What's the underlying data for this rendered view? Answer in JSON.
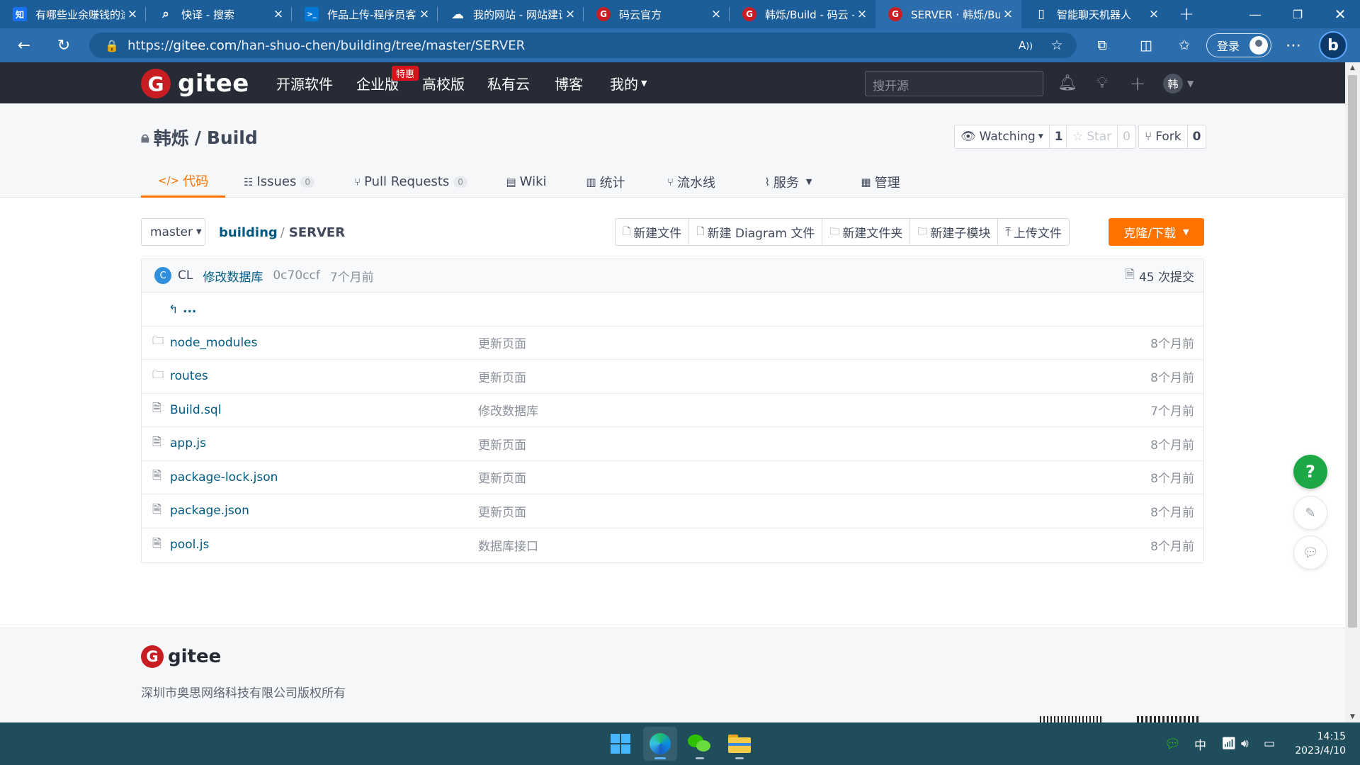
{
  "browser": {
    "tabs": [
      {
        "label": "有哪些业余赚钱的途径",
        "favicon": "知",
        "favicon_color": "#1772f6"
      },
      {
        "label": "快译 - 搜索",
        "favicon": "⌕",
        "favicon_color": "#2c6ead"
      },
      {
        "label": "作品上传-程序员客栈",
        "favicon": ">_",
        "favicon_color": "#0078d4"
      },
      {
        "label": "我的网站 - 网站建设",
        "favicon": "☁",
        "favicon_color": "#2c6ead"
      },
      {
        "label": "码云官方",
        "favicon": "G",
        "favicon_color": "#c71d23"
      },
      {
        "label": "韩烁/Build - 码云 - 开源中国",
        "favicon": "G",
        "favicon_color": "#c71d23"
      },
      {
        "label": "SERVER · 韩烁/Build - 码云",
        "favicon": "G",
        "favicon_color": "#c71d23"
      },
      {
        "label": "智能聊天机器人",
        "favicon": "▯",
        "favicon_color": "#2c6ead"
      }
    ],
    "url_prefix": "https://",
    "url_domain": "gitee.com",
    "url_path": "/han-shuo-chen/building/tree/master/SERVER",
    "login_label": "登录"
  },
  "gitee": {
    "brand": "gitee",
    "nav": [
      "开源软件",
      "企业版",
      "高校版",
      "私有云",
      "博客",
      "我的"
    ],
    "hot_badge": "特惠",
    "search_placeholder": "搜开源",
    "user_avatar": "韩"
  },
  "repo": {
    "owner": "韩烁",
    "name": "Build",
    "watching_label": "Watching",
    "watching_count": "1",
    "star_label": "Star",
    "star_count": "0",
    "fork_label": "Fork",
    "fork_count": "0",
    "tabs": [
      {
        "label": "代码",
        "icon": "</>"
      },
      {
        "label": "Issues",
        "icon": "☷",
        "count": "0"
      },
      {
        "label": "Pull Requests",
        "icon": "⑂",
        "count": "0"
      },
      {
        "label": "Wiki",
        "icon": "▤"
      },
      {
        "label": "统计",
        "icon": "▥"
      },
      {
        "label": "流水线",
        "icon": "⑂"
      },
      {
        "label": "服务",
        "icon": "⌇"
      },
      {
        "label": "管理",
        "icon": "▦"
      }
    ]
  },
  "toolbar": {
    "branch": "master",
    "path_root": "building",
    "path_current": "SERVER",
    "actions": [
      "新建文件",
      "新建 Diagram 文件",
      "新建文件夹",
      "新建子模块",
      "上传文件"
    ],
    "clone_label": "克隆/下载"
  },
  "commit": {
    "avatar": "C",
    "author": "CL",
    "message": "修改数据库",
    "sha": "0c70ccf",
    "time": "7个月前",
    "count_label": "45 次提交"
  },
  "files": {
    "parent_label": "...",
    "rows": [
      {
        "type": "dir",
        "name": "node_modules",
        "message": "更新页面",
        "time": "8个月前"
      },
      {
        "type": "dir",
        "name": "routes",
        "message": "更新页面",
        "time": "8个月前"
      },
      {
        "type": "file",
        "name": "Build.sql",
        "message": "修改数据库",
        "time": "7个月前"
      },
      {
        "type": "file",
        "name": "app.js",
        "message": "更新页面",
        "time": "8个月前"
      },
      {
        "type": "file",
        "name": "package-lock.json",
        "message": "更新页面",
        "time": "8个月前"
      },
      {
        "type": "file",
        "name": "package.json",
        "message": "更新页面",
        "time": "8个月前"
      },
      {
        "type": "file",
        "name": "pool.js",
        "message": "数据库接口",
        "time": "8个月前"
      }
    ]
  },
  "footer": {
    "brand": "gitee",
    "copyright": "深圳市奥思网络科技有限公司版权所有"
  },
  "taskbar": {
    "ime": "中",
    "time": "14:15",
    "date": "2023/4/10"
  },
  "colors": {
    "accent": "#fe7300",
    "brand": "#c71d23",
    "link": "#005980",
    "browser_chrome": "#2c6ead"
  }
}
